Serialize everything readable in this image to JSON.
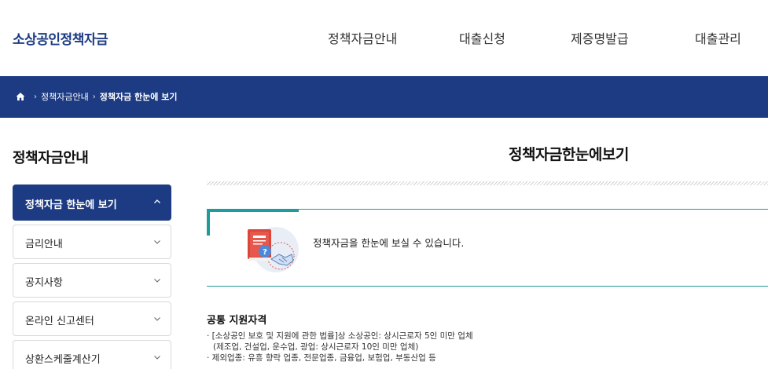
{
  "header": {
    "logo": "소상공인정책자금",
    "nav": [
      "정책자금안내",
      "대출신청",
      "제증명발급",
      "대출관리"
    ]
  },
  "breadcrumb": {
    "items": [
      "정책자금안내",
      "정책자금 한눈에 보기"
    ]
  },
  "sidebar": {
    "title": "정책자금안내",
    "items": [
      {
        "label": "정책자금 한눈에 보기",
        "active": true
      },
      {
        "label": "금리안내"
      },
      {
        "label": "공지사항"
      },
      {
        "label": "온라인 신고센터"
      },
      {
        "label": "상환스케줄계산기"
      }
    ]
  },
  "main": {
    "title": "정책자금한눈에보기",
    "intro": "정책자금을 한눈에 보실 수 있습니다.",
    "section_title": "공통 지원자격",
    "bullets": [
      "· [소상공인 보호 및 지원에 관한 법률]상 소상공인: 상시근로자 5인 미만 업체",
      "(제조업, 건설업, 운수업, 광업: 상시근로자 10인 미만 업체)",
      "· 제외업종: 유흥 향락 업종, 전문업종, 금융업, 보험업, 부동산업 등"
    ]
  },
  "colors": {
    "brand": "#1c3b82",
    "accent": "#1e9b9b"
  },
  "icons": [
    "home-icon",
    "chevron-down-icon",
    "chevron-up-icon",
    "book-handshake-illustration"
  ]
}
